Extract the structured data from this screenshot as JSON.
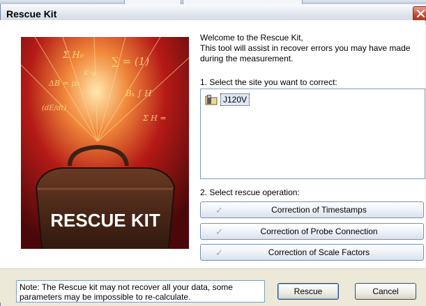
{
  "window": {
    "title": "Rescue Kit"
  },
  "welcome": {
    "line1": "Welcome to the Rescue Kit,",
    "line2": "This tool will assist in recover errors you may have made",
    "line3": "during the measurement."
  },
  "step1": {
    "label": "1. Select the site you want to correct:",
    "sites": [
      {
        "name": "J120V",
        "icon": "site-folder-icon"
      }
    ]
  },
  "step2": {
    "label": "2. Select rescue operation:",
    "operations": [
      {
        "label": "Correction of Timestamps",
        "check": "✓"
      },
      {
        "label": "Correction of Probe Connection",
        "check": "✓"
      },
      {
        "label": "Correction of Scale Factors",
        "check": "✓"
      }
    ]
  },
  "footer": {
    "note_line1": "Note: The Rescue kit may not recover all your data, some",
    "note_line2": "parameters may be impossible to re-calculate.",
    "rescue_label": "Rescue",
    "cancel_label": "Cancel"
  },
  "hero": {
    "bag_text": "RESCUE KIT"
  },
  "colors": {
    "hero_red": "#8b0f12",
    "button_border": "#7391b6",
    "close_red": "#c9452a"
  }
}
